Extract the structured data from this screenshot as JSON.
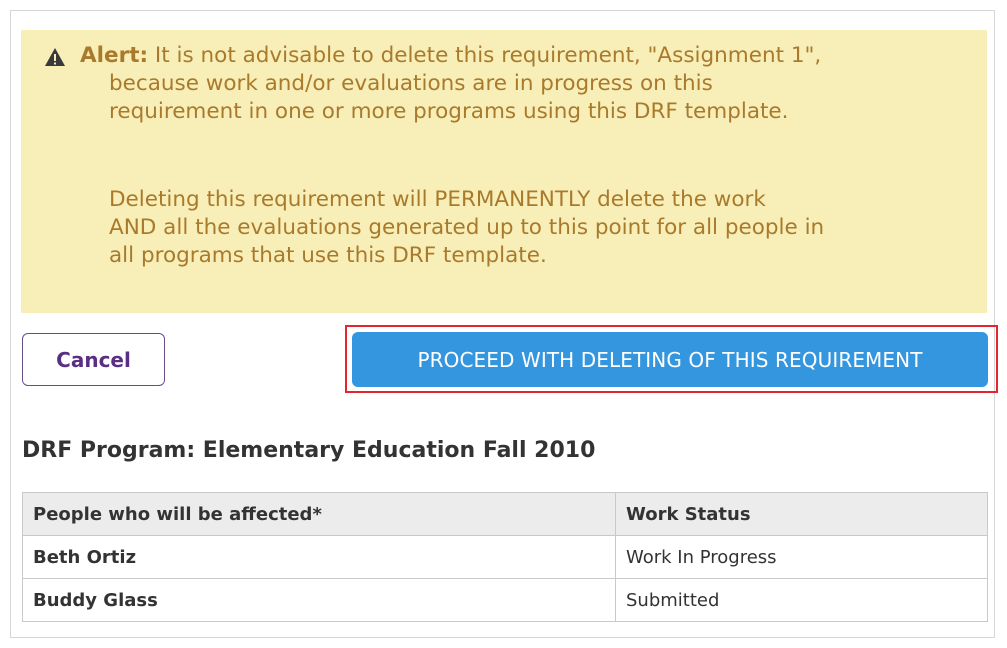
{
  "alert": {
    "label": "Alert:",
    "line1": "It is not advisable to delete this requirement, \"Assignment 1\",",
    "line2": "because work and/or evaluations are in progress on this",
    "line3": "requirement in one or more programs using this DRF template.",
    "line4": "Deleting this requirement will PERMANENTLY delete the work",
    "line5": "AND all the evaluations generated up to this point for all people in",
    "line6": "all programs that use this DRF template.",
    "icon": "warning-triangle-icon",
    "text_color": "#a97a2c",
    "background_color": "#f8eeb7"
  },
  "actions": {
    "cancel_label": "Cancel",
    "proceed_label": "PROCEED WITH DELETING OF THIS REQUIREMENT",
    "proceed_color": "#3496df",
    "highlight_color": "#e3252d"
  },
  "program": {
    "title": "DRF Program: Elementary Education Fall 2010"
  },
  "table": {
    "headers": [
      "People who will be affected*",
      "Work Status"
    ],
    "rows": [
      {
        "name": "Beth Ortiz",
        "status": "Work In Progress"
      },
      {
        "name": "Buddy Glass",
        "status": "Submitted"
      }
    ]
  }
}
